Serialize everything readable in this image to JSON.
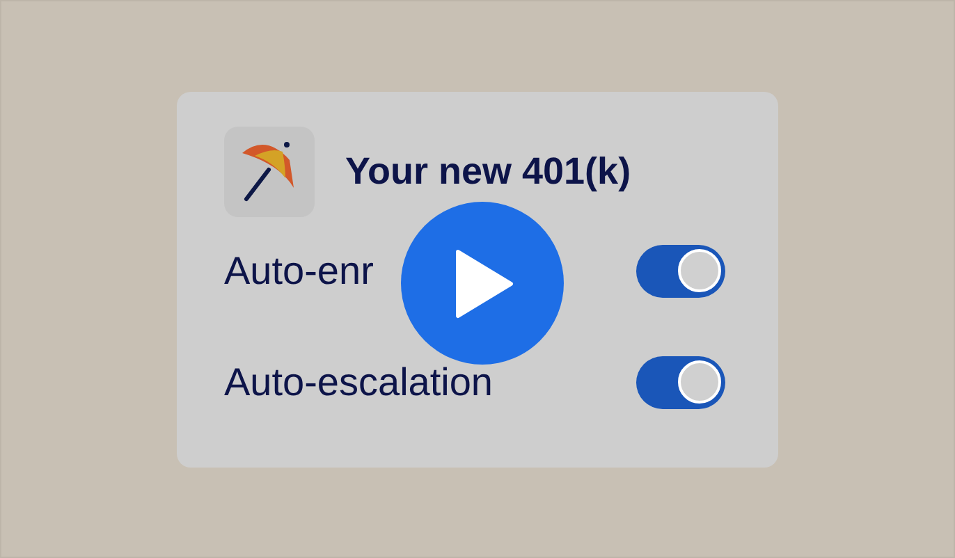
{
  "card": {
    "title": "Your new 401(k)"
  },
  "settings": [
    {
      "label": "Auto-enr",
      "on": true
    },
    {
      "label": "Auto-escalation",
      "on": true
    }
  ]
}
